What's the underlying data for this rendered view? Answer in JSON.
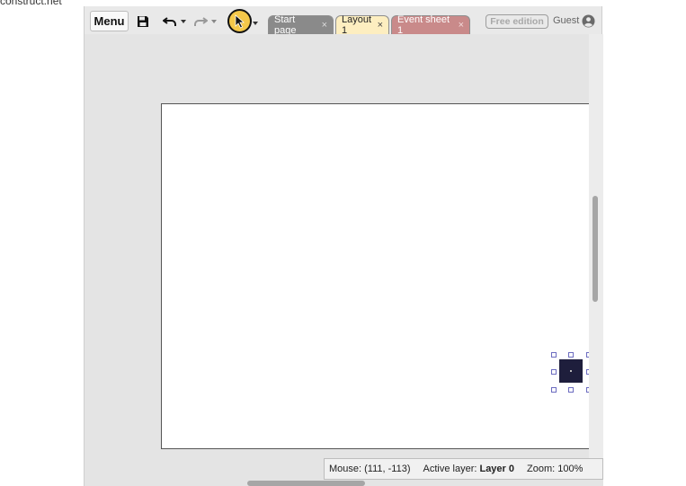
{
  "browser": {
    "url_fragment": "construct.net"
  },
  "toolbar": {
    "menu_label": "Menu",
    "icons": {
      "save": "save-icon",
      "undo": "undo-icon",
      "redo": "redo-icon",
      "select": "pointer-icon"
    },
    "tool_active_color": "#f4c84a"
  },
  "tabs": [
    {
      "label": "Start page",
      "close": "×",
      "color": "#8a8a8a"
    },
    {
      "label": "Layout 1",
      "close": "×",
      "color": "#fdeec0"
    },
    {
      "label": "Event sheet 1",
      "close": "×",
      "color": "#c98a8a"
    }
  ],
  "account": {
    "edition_label": "Free edition",
    "user_label": "Guest"
  },
  "status": {
    "mouse_label": "Mouse: (111, -113)",
    "layer_prefix": "Active layer: ",
    "layer_name": "Layer 0",
    "zoom_label": "Zoom: 100%"
  },
  "sprite": {
    "color": "#1e1e3c"
  }
}
